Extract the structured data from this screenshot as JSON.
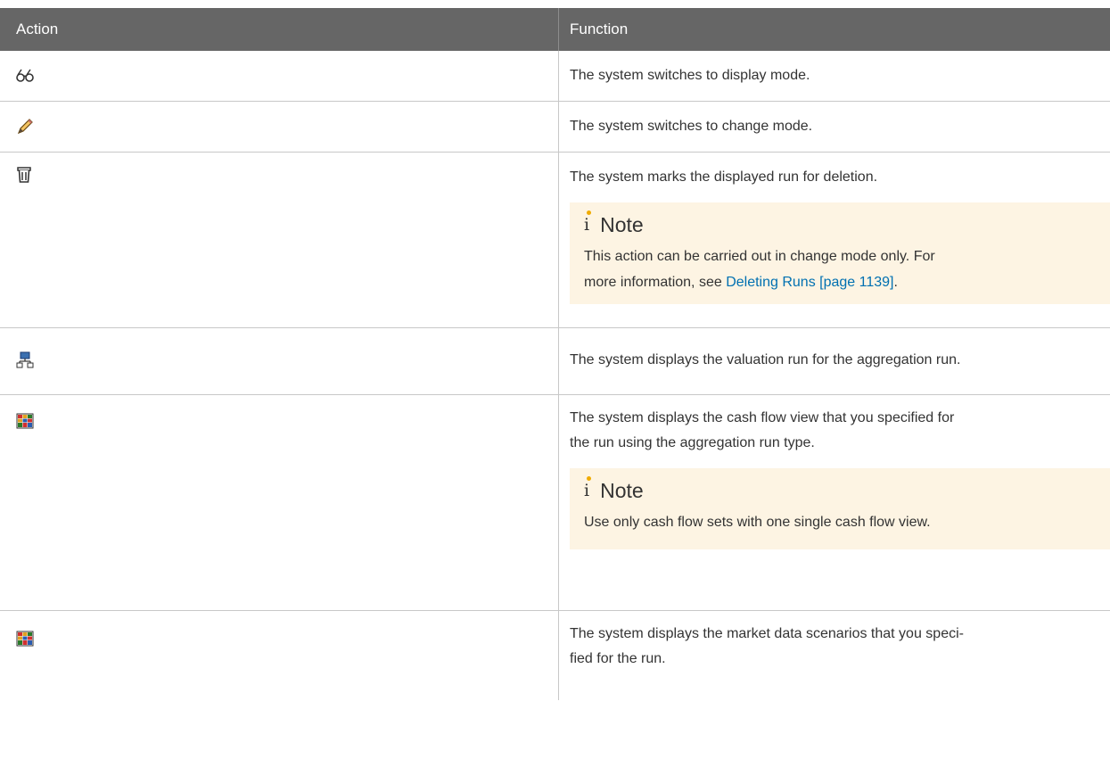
{
  "header": {
    "action": "Action",
    "function": "Function"
  },
  "rows": [
    {
      "icon": "glasses-icon",
      "text": "The system switches to display mode."
    },
    {
      "icon": "pencil-icon",
      "text": "The system switches to change mode."
    },
    {
      "icon": "trash-icon",
      "text": "The system marks the displayed run for deletion.",
      "note_title": "Note",
      "note_text_1": "This action can be carried out in change mode only. For",
      "note_text_2": "more information, see ",
      "note_link": "Deleting Runs [page 1139]",
      "note_text_3": "."
    },
    {
      "icon": "hierarchy-icon",
      "text": "The system displays the valuation run for the aggregation run."
    },
    {
      "icon": "table-grid-icon",
      "text_1": "The system displays the cash flow view that you specified for",
      "text_2": "the run using the aggregation run type.",
      "note_title": "Note",
      "note_text": "Use only cash flow sets with one single cash flow view."
    },
    {
      "icon": "table-grid-icon",
      "text_1": "The system displays the market data scenarios that you speci-",
      "text_2": "fied for the run."
    }
  ],
  "colors": {
    "header_bg": "#666666",
    "note_bg": "#fdf4e3",
    "link": "#0070b1",
    "note_dot": "#f0ab00"
  }
}
